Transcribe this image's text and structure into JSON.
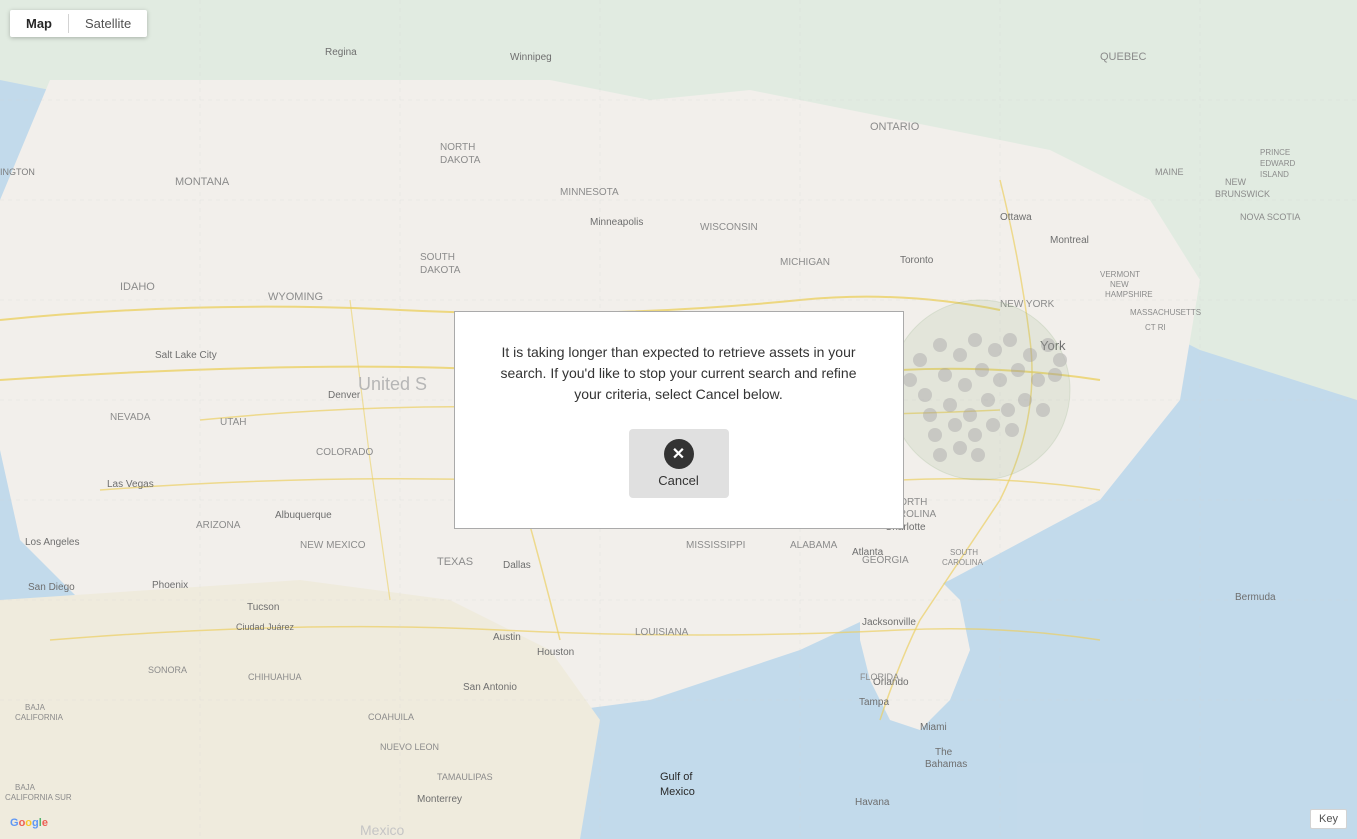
{
  "map": {
    "type_toggle": {
      "map_label": "Map",
      "satellite_label": "Satellite",
      "active": "map"
    },
    "york_label": "York",
    "google_label": "Google",
    "key_label": "Key"
  },
  "modal": {
    "message": "It is taking longer than expected to retrieve assets in your search. If you'd like to stop your current search and refine your criteria, select Cancel below.",
    "cancel_label": "Cancel",
    "cancel_icon": "✕"
  },
  "colors": {
    "map_bg": "#e8f0e8",
    "water": "#b3d4e8",
    "land_us": "#f5f5f0",
    "land_canada": "#e8ede8",
    "land_mexico": "#f0ede0",
    "roads": "#f0c060",
    "cluster": "rgba(100,130,100,0.5)"
  }
}
